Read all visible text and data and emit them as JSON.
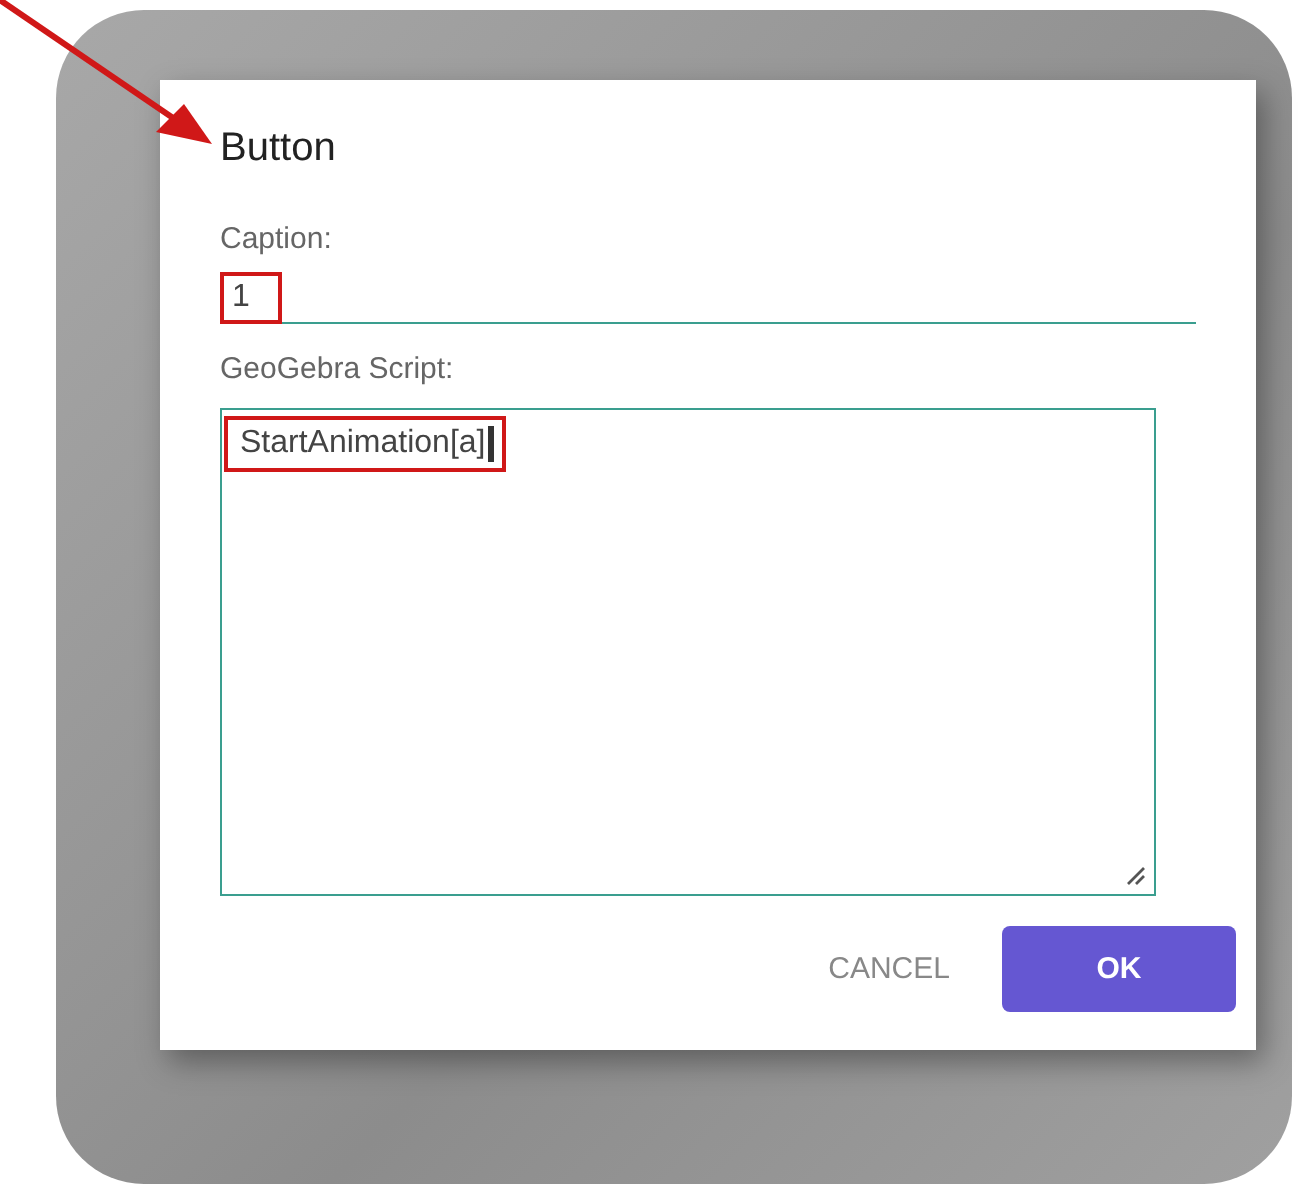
{
  "pointer_arrow": true,
  "dialog": {
    "title": "Button",
    "caption": {
      "label": "Caption:",
      "value": "1",
      "highlighted": true
    },
    "script": {
      "label": "GeoGebra Script:",
      "value": "StartAnimation[a]",
      "highlighted": true,
      "cursor": true
    },
    "buttons": [
      {
        "label": "CANCEL",
        "kind": "text"
      },
      {
        "label": "OK",
        "kind": "primary"
      }
    ]
  }
}
